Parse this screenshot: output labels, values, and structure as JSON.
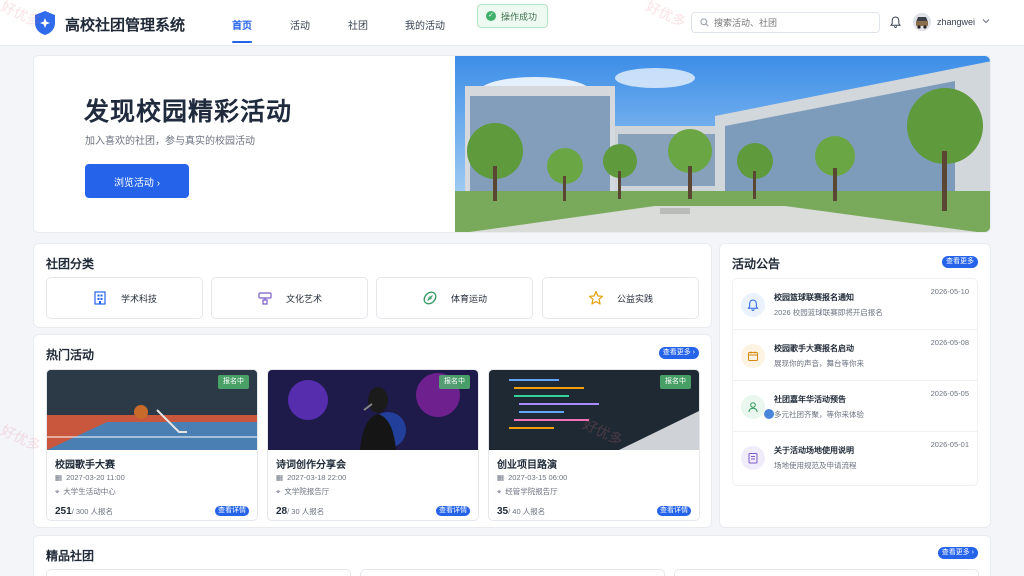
{
  "app": {
    "title": "高校社团管理系统",
    "username": "zhangwei"
  },
  "nav": [
    {
      "label": "首页",
      "active": true
    },
    {
      "label": "活动",
      "active": false
    },
    {
      "label": "社团",
      "active": false
    },
    {
      "label": "我的活动",
      "active": false
    }
  ],
  "toast": {
    "text": "操作成功",
    "icon": "check-circle-icon"
  },
  "search": {
    "placeholder": "搜索活动、社团"
  },
  "watermark": {
    "text": "好优多"
  },
  "hero": {
    "title": "发现校园精彩活动",
    "subtitle": "加入喜欢的社团，参与真实的校园活动",
    "button": "浏览活动 ›"
  },
  "categories": {
    "title": "社团分类",
    "items": [
      {
        "label": "学术科技",
        "icon": "building-icon"
      },
      {
        "label": "文化艺术",
        "icon": "palette-icon"
      },
      {
        "label": "体育运动",
        "icon": "football-icon"
      },
      {
        "label": "公益实践",
        "icon": "star-icon"
      }
    ]
  },
  "hot": {
    "title": "热门活动",
    "more": "查看更多 ›",
    "cards": [
      {
        "title": "校园歌手大赛",
        "badge": "报名中",
        "time": "2027-03-20 11:00",
        "place": "大学生活动中心",
        "count": "251",
        "total": "/ 300 人报名",
        "detail": "查看详情"
      },
      {
        "title": "诗词创作分享会",
        "badge": "报名中",
        "time": "2027-03-18 22:00",
        "place": "文学院报告厅",
        "count": "28",
        "total": "/ 30 人报名",
        "detail": "查看详情"
      },
      {
        "title": "创业项目路演",
        "badge": "报名中",
        "time": "2027-03-15 06:00",
        "place": "经管学院报告厅",
        "count": "35",
        "total": "/ 40 人报名",
        "detail": "查看详情"
      }
    ]
  },
  "notices": {
    "title": "活动公告",
    "more": "查看更多",
    "items": [
      {
        "title": "校园篮球联赛报名通知",
        "desc": "2026 校园篮球联赛即将开启报名",
        "date": "2026-05-10",
        "icon": "bell-icon",
        "color": "#eaf2fe"
      },
      {
        "title": "校园歌手大赛报名启动",
        "desc": "展现你的声音，舞台等你来",
        "date": "2026-05-08",
        "icon": "calendar-icon",
        "color": "#fdf3e3"
      },
      {
        "title": "社团嘉年华活动预告",
        "desc": "多元社团齐聚，等你来体验",
        "date": "2026-05-05",
        "icon": "user-icon",
        "color": "#e9f7ef"
      },
      {
        "title": "关于活动场地使用说明",
        "desc": "场地使用规范及申请流程",
        "date": "2026-05-01",
        "icon": "document-icon",
        "color": "#f1ecfb"
      }
    ]
  },
  "featured": {
    "title": "精品社团",
    "more": "查看更多 ›"
  }
}
